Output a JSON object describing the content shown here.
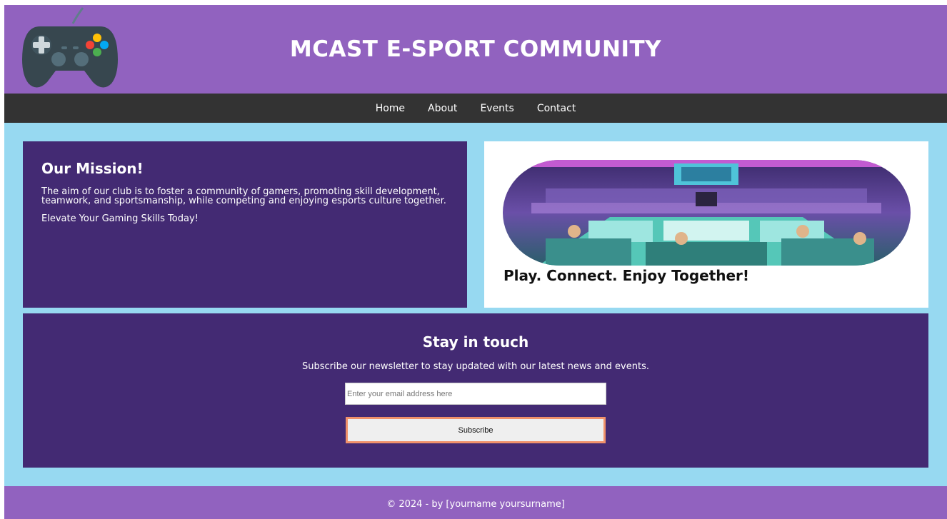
{
  "header": {
    "title": "MCAST E-SPORT COMMUNITY",
    "logo_icon": "gamepad-icon"
  },
  "nav": {
    "items": [
      {
        "label": "Home"
      },
      {
        "label": "About"
      },
      {
        "label": "Events"
      },
      {
        "label": "Contact"
      }
    ]
  },
  "mission": {
    "heading": "Our Mission!",
    "text": "The aim of our club is to foster a community of gamers, promoting skill development, teamwork, and sportsmanship, while competing and enjoying esports culture together.",
    "tagline": "Elevate Your Gaming Skills Today!"
  },
  "image_card": {
    "caption": "Play. Connect. Enjoy Together!"
  },
  "newsletter": {
    "heading": "Stay in touch",
    "text": "Subscribe our newsletter to stay updated with our latest news and events.",
    "email_placeholder": "Enter your email address here",
    "email_value": "",
    "button_label": "Subscribe"
  },
  "footer": {
    "text": "© 2024 - by [yourname yoursurname]"
  },
  "colors": {
    "header_bg": "#9162bf",
    "nav_bg": "#333333",
    "page_bg": "#97d9f1",
    "panel_bg": "#432a73",
    "button_border": "#f0926b"
  }
}
